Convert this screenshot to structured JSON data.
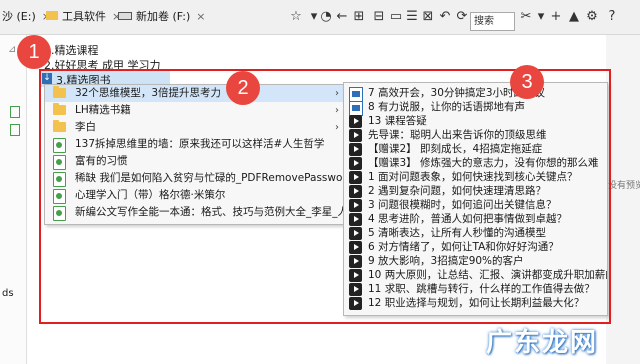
{
  "tabs": [
    {
      "label": "沙 (E:)",
      "close": "×"
    },
    {
      "label": "工具软件",
      "close": "×"
    },
    {
      "label": "新加卷 (F:)",
      "close": "×"
    }
  ],
  "search": {
    "text": "搜索"
  },
  "tree": [
    "1.精选课程",
    "2.好好思考 成甲 学习力",
    "3.精选图书"
  ],
  "left_panel_text": "ds",
  "right_edge_text": "没有预览",
  "menu1": [
    {
      "label": "32个思维模型，3倍提升思考力",
      "icon": "folder-icon",
      "submenu": true,
      "highlight": true
    },
    {
      "label": "LH精选书籍",
      "icon": "folder-icon",
      "submenu": true
    },
    {
      "label": "李白",
      "icon": "folder-icon",
      "submenu": true
    },
    {
      "label": "137拆掉思维里的墙：原来我还可以这样活#人生哲学",
      "icon": "file-icon"
    },
    {
      "label": "富有的习惯",
      "icon": "file-icon"
    },
    {
      "label": "稀缺 我们是如何陷入贫穷与忙碌的_PDFRemovePassword",
      "icon": "file-icon"
    },
    {
      "label": "心理学入门（带）格尔德·米策尔",
      "icon": "file-icon"
    },
    {
      "label": "新编公文写作全能一本通：格式、技巧与范例大全_李星_人民邮电",
      "icon": "file-icon"
    }
  ],
  "menu2": [
    {
      "label": "7 高效开会，30分钟搞定3小时的会议",
      "icon": "doc-icon"
    },
    {
      "label": "8 有力说服，让你的话语掷地有声",
      "icon": "doc-icon"
    },
    {
      "label": "13 课程答疑",
      "icon": "video-icon"
    },
    {
      "label": "先导课：聪明人出来告诉你的顶级思维",
      "icon": "video-icon"
    },
    {
      "label": "【赠课2】 即刻成长，4招搞定拖延症",
      "icon": "video-icon"
    },
    {
      "label": "【赠课3】 修炼强大的意志力，没有你想的那么难",
      "icon": "video-icon"
    },
    {
      "label": "1 面对问题表象，如何快速找到核心关键点？",
      "icon": "video-icon"
    },
    {
      "label": "2 遇到复杂问题，如何快速理清思路？",
      "icon": "video-icon"
    },
    {
      "label": "3 问题很模糊时，如何追问出关键信息？",
      "icon": "video-icon"
    },
    {
      "label": "4 思考进阶，普通人如何把事情做到卓越？",
      "icon": "video-icon"
    },
    {
      "label": "5 清晰表达，让所有人秒懂的沟通模型",
      "icon": "video-icon"
    },
    {
      "label": "6 对方情绪了，如何让TA和你好好沟通？",
      "icon": "video-icon"
    },
    {
      "label": "9 放大影响，3招搞定90%的客户",
      "icon": "video-icon"
    },
    {
      "label": "10 两大原则，让总结、汇报、演讲都变成升职加薪的机会",
      "icon": "video-icon"
    },
    {
      "label": "11 求职、跳槽与转行，什么样的工作值得去做？",
      "icon": "video-icon"
    },
    {
      "label": "12 职业选择与规划，如何让长期利益最大化？",
      "icon": "video-icon"
    }
  ],
  "badges": [
    "1",
    "2",
    "3"
  ],
  "watermark": "广东龙网",
  "colors": {
    "annotation_red": "#e0201f",
    "badge_red": "#e8463e",
    "highlight_blue": "#d3e5f8"
  }
}
